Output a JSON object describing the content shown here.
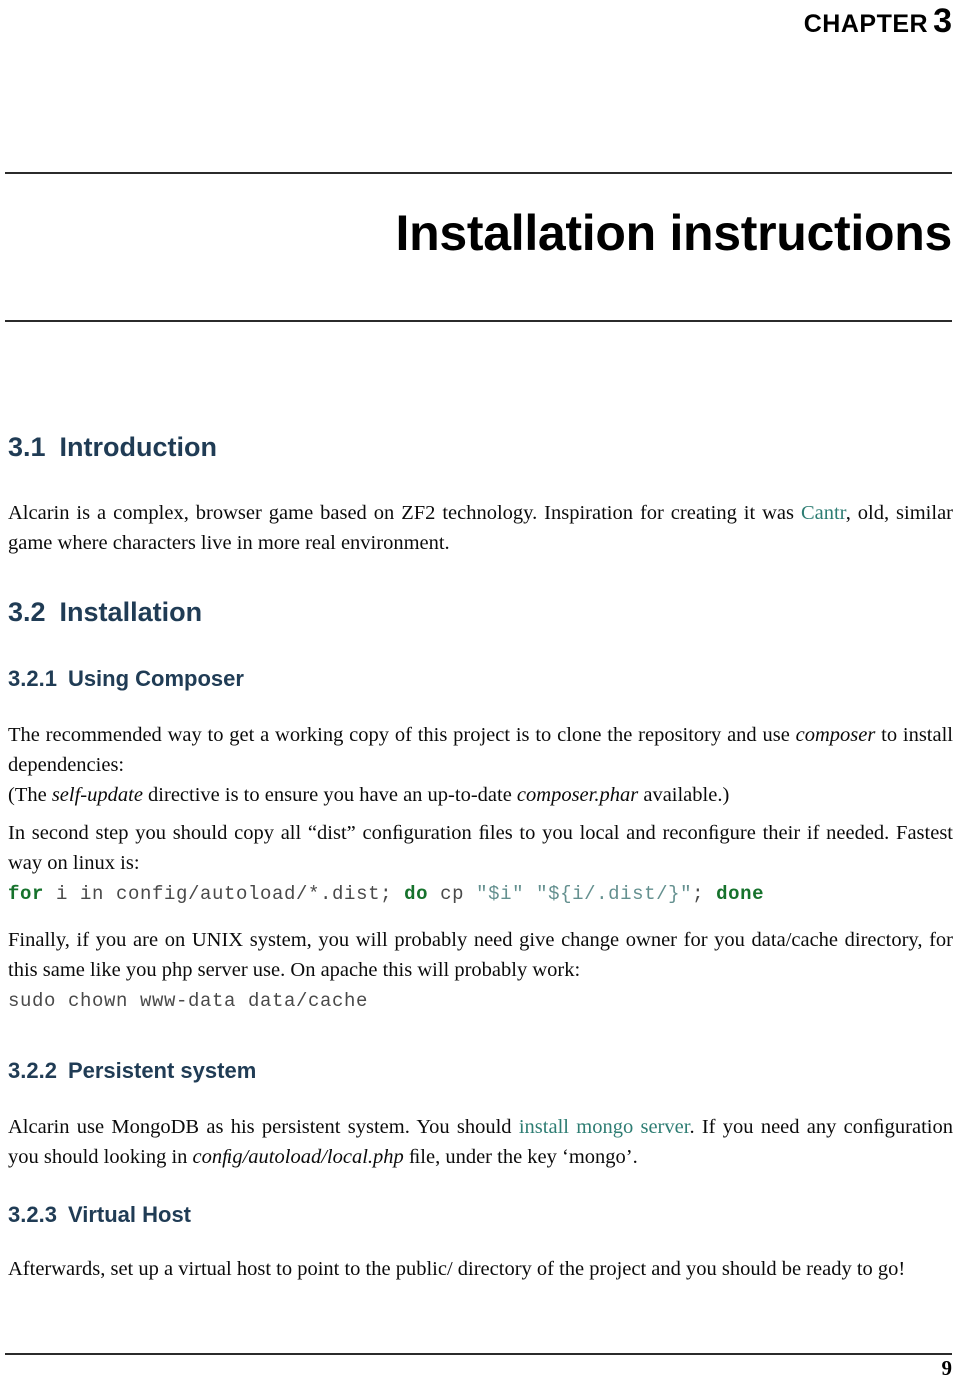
{
  "header": {
    "chapter_word": "CHAPTER",
    "chapter_number": "3"
  },
  "title": "Installation instructions",
  "sections": [
    {
      "id": "introduction",
      "number": "3.1",
      "title": "Introduction",
      "level": 1
    },
    {
      "id": "installation",
      "number": "3.2",
      "title": "Installation",
      "level": 1
    },
    {
      "id": "using-composer",
      "number": "3.2.1",
      "title": "Using Composer",
      "level": 2
    },
    {
      "id": "persistent-system",
      "number": "3.2.2",
      "title": "Persistent system",
      "level": 2
    },
    {
      "id": "virtual-host",
      "number": "3.2.3",
      "title": "Virtual Host",
      "level": 2
    }
  ],
  "paragraphs": {
    "intro": {
      "part1": "Alcarin is a complex, browser game based on ZF2 technology. Inspiration for creating it was ",
      "link": "Cantr",
      "part2": ", old, similar game where characters live in more real environment."
    },
    "composer_intro": {
      "part1": "The recommended way to get a working copy of this project is to clone the repository and use ",
      "em1": "composer",
      "part2": " to install dependencies:"
    },
    "self_update_note": {
      "part1": "(The ",
      "em1": "self-update",
      "part2": " directive is to ensure you have an up-to-date ",
      "em2": "composer.phar",
      "part3": " available.)"
    },
    "dist_copy": "In second step you should copy all “dist” conﬁguration ﬁles to you local and reconﬁgure their if needed. Fastest way on linux is:",
    "unix_owner": "Finally, if you are on UNIX system, you will probably need give change owner for you data/cache directory, for this same like you php server use. On apache this will probably work:",
    "mongo": {
      "part1": "Alcarin use MongoDB as his persistent system. You should ",
      "link": "install mongo server",
      "part2": ". If you need any conﬁguration you should looking in ",
      "em1": "conﬁg/autoload/local.php",
      "part3": " ﬁle, under the key ‘mongo’."
    },
    "vhost": "Afterwards, set up a virtual host to point to the public/ directory of the project and you should be ready to go!"
  },
  "code_blocks": {
    "dist_loop": {
      "tokens": [
        {
          "text": "for",
          "kind": "keyword"
        },
        {
          "text": " i in config/autoload/*.dist; ",
          "kind": "plain"
        },
        {
          "text": "do",
          "kind": "keyword"
        },
        {
          "text": " cp ",
          "kind": "plain"
        },
        {
          "text": "\"$i\" \"${i/.dist/}\"",
          "kind": "string"
        },
        {
          "text": "; ",
          "kind": "plain"
        },
        {
          "text": "done",
          "kind": "keyword"
        }
      ],
      "plain_text": "for i in config/autoload/*.dist; do cp \"$i\" \"${i/.dist/}\"; done"
    },
    "chown": {
      "tokens": [
        {
          "text": "sudo chown www-data data/cache",
          "kind": "plain"
        }
      ],
      "plain_text": "sudo chown www-data data/cache"
    }
  },
  "footer": {
    "page_number": "9"
  },
  "colors": {
    "heading": "#203c55",
    "link": "#2e7d73",
    "code_keyword": "#16722c",
    "code_string": "#64908f",
    "code_plain": "#4f4f4f",
    "rule": "#2b2b2b"
  }
}
